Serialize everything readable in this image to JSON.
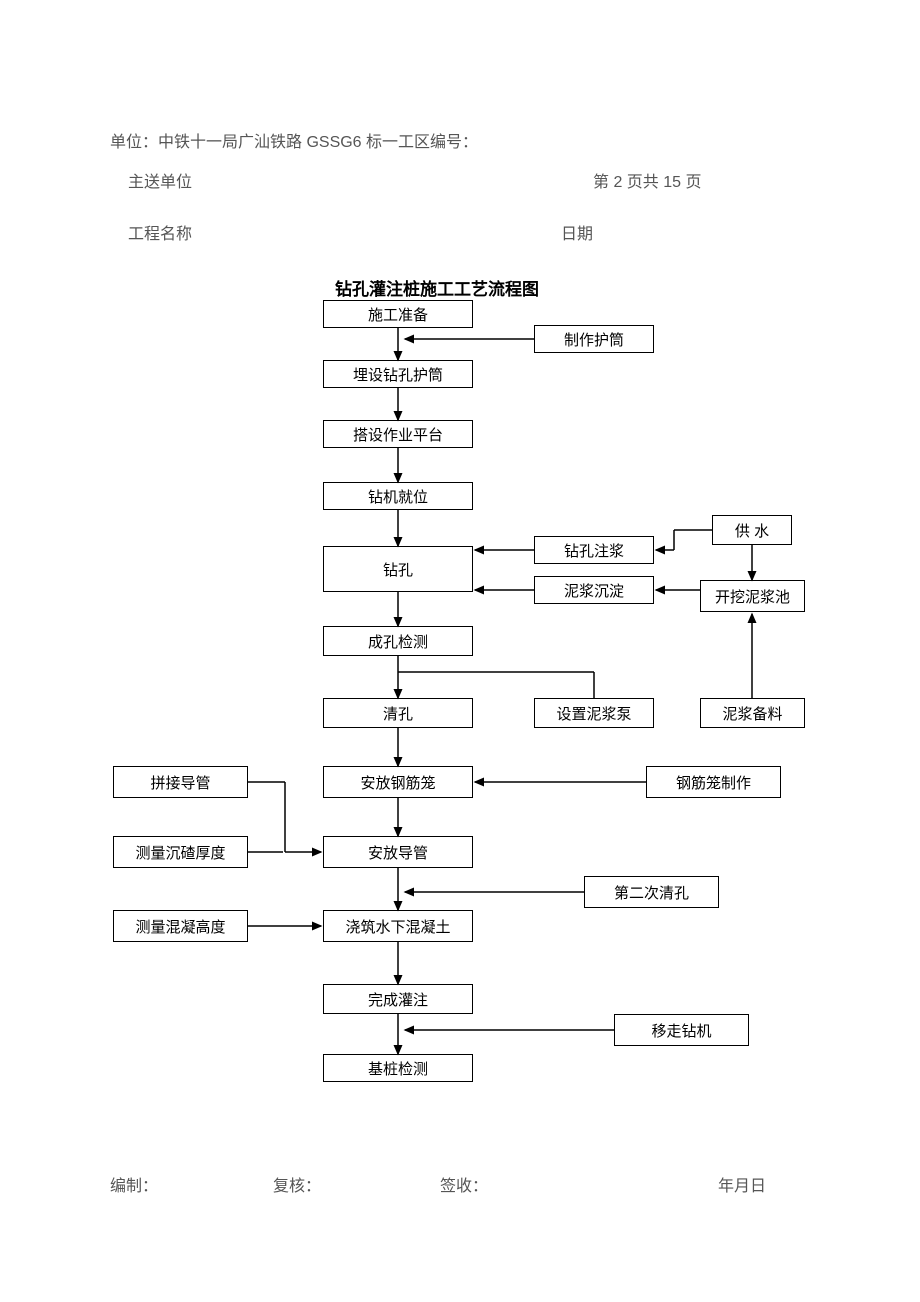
{
  "header": {
    "unit_line": "单位：中铁十一局广汕铁路 GSSG6 标一工区编号：",
    "send_to": "主送单位",
    "page_info": "第 2 页共 15 页",
    "project_name": "工程名称",
    "date_label": "日期"
  },
  "diagram": {
    "title": "钻孔灌注桩施工工艺流程图",
    "nodes": {
      "prep": "施工准备",
      "make_casing": "制作护筒",
      "bury_casing": "埋设钻孔护筒",
      "platform": "搭设作业平台",
      "drill_pos": "钻机就位",
      "water": "供 水",
      "drill": "钻孔",
      "grout": "钻孔注浆",
      "mud_settle": "泥浆沉淀",
      "dig_pool": "开挖泥浆池",
      "hole_test": "成孔检测",
      "clean_hole": "清孔",
      "mud_pump": "设置泥浆泵",
      "mud_material": "泥浆备料",
      "splice_pipe": "拼接导管",
      "place_cage": "安放钢筋笼",
      "make_cage": "钢筋笼制作",
      "measure_sed": "测量沉碴厚度",
      "place_pipe": "安放导管",
      "second_clean": "第二次清孔",
      "measure_conc": "测量混凝高度",
      "pour_conc": "浇筑水下混凝土",
      "finish_pour": "完成灌注",
      "move_drill": "移走钻机",
      "pile_test": "基桩检测"
    }
  },
  "footer": {
    "compile": "编制：",
    "review": "复核：",
    "receive": "签收：",
    "date": "年月日"
  }
}
